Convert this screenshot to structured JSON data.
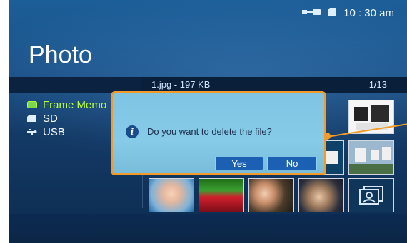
{
  "status": {
    "time": "10 : 30 am",
    "icons": [
      "usb-icon",
      "sd-card-icon"
    ]
  },
  "screen": {
    "title": "Photo"
  },
  "file_bar": {
    "file_info": "1.jpg - 197 KB",
    "page": "1/13"
  },
  "sidebar": {
    "items": [
      {
        "label": "Frame Memo",
        "icon": "frame-memory-icon",
        "active": true
      },
      {
        "label": "SD",
        "icon": "sd-card-icon",
        "active": false
      },
      {
        "label": "USB",
        "icon": "usb-icon",
        "active": false
      }
    ]
  },
  "dialog": {
    "message": "Do you want to delete the file?",
    "yes_label": "Yes",
    "no_label": "No",
    "icon": "info-icon"
  },
  "colors": {
    "accent": "#f29b2a",
    "active_green": "#b8ff3a",
    "button_blue": "#1b60b3",
    "dialog_bg": "#86cbe8"
  }
}
